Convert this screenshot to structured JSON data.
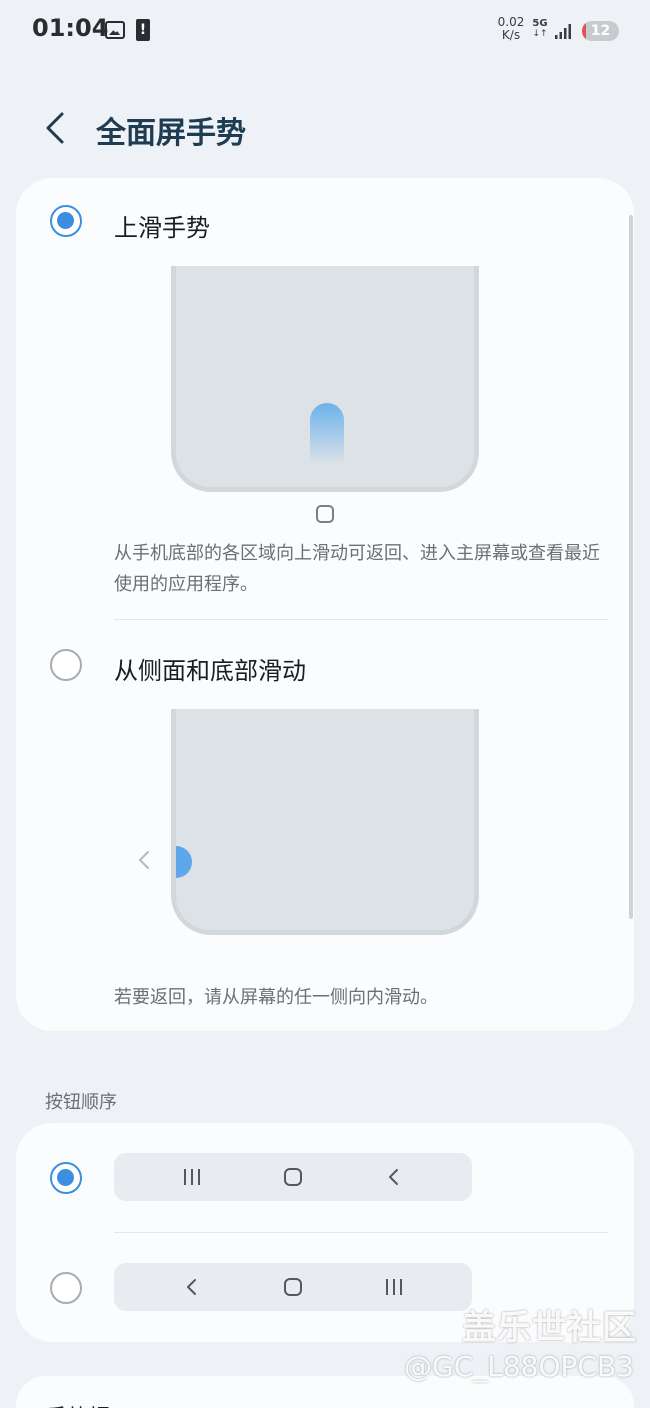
{
  "status_bar": {
    "time": "01:04",
    "net_speed_value": "0.02",
    "net_speed_unit": "K/s",
    "network_type": "5G",
    "battery_level": "12",
    "icons": [
      "image-icon",
      "alert-icon",
      "signal-icon",
      "battery-icon"
    ]
  },
  "header": {
    "title": "全面屏手势",
    "back_icon": "chevron-left-icon"
  },
  "gestures": {
    "option_swipe_up": {
      "label": "上滑手势",
      "selected": true,
      "description": "从手机底部的各区域向上滑动可返回、进入主屏幕或查看最近使用的应用程序。"
    },
    "option_side_bottom": {
      "label": "从侧面和底部滑动",
      "selected": false,
      "description": "若要返回，请从屏幕的任一侧向内滑动。"
    }
  },
  "button_order": {
    "section_title": "按钮顺序",
    "options": [
      {
        "selected": true,
        "buttons": [
          "recents-icon",
          "home-icon",
          "back-icon"
        ]
      },
      {
        "selected": false,
        "buttons": [
          "back-icon",
          "home-icon",
          "recents-icon"
        ]
      }
    ]
  },
  "bottom_peek_label": "手势提",
  "watermark": {
    "line1": "盖乐世社区",
    "line2": "@GC_L88OPCB3"
  },
  "colors": {
    "accent": "#3c8fe0",
    "background": "#eef1f5",
    "card": "#fbfcfd",
    "title": "#1e3c52"
  }
}
